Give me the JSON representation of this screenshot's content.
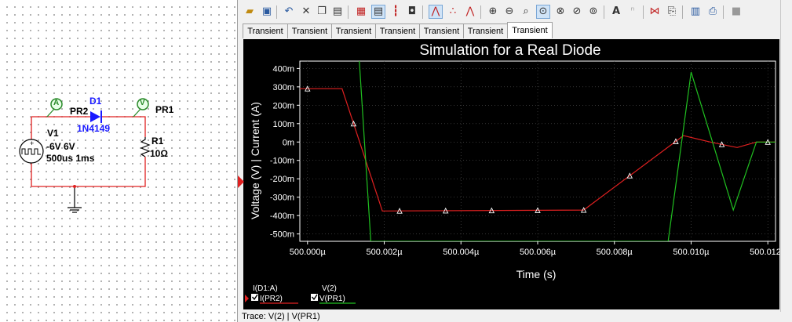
{
  "schematic": {
    "probe1": {
      "symbol": "A",
      "label": "PR2"
    },
    "probe2": {
      "symbol": "V",
      "label": "PR1"
    },
    "diode": {
      "ref": "D1",
      "model": "1N4149"
    },
    "source": {
      "ref": "V1",
      "line1": "-6V 6V",
      "line2": "500us 1ms"
    },
    "resistor": {
      "ref": "R1",
      "value": "10Ω"
    }
  },
  "toolbar": {
    "icons": [
      "open-icon",
      "save-icon",
      "undo-icon",
      "delete-icon",
      "copy-icon",
      "paste-icon",
      "grid-icon",
      "legend-icon",
      "cursor-icon",
      "dark-bg-icon",
      "line-plot-icon",
      "dot-plot-icon",
      "dotline-plot-icon",
      "zoom-in-icon",
      "zoom-out-icon",
      "zoom-area-icon",
      "zoom-full-icon",
      "zoom-x-icon",
      "zoom-y-icon",
      "text-icon",
      "overlay-icon",
      "add-trace-icon",
      "export-icon",
      "print-icon",
      "stop-icon"
    ]
  },
  "tabs": [
    "Transient",
    "Transient",
    "Transient",
    "Transient",
    "Transient",
    "Transient",
    "Transient"
  ],
  "active_tab": 6,
  "status_text": "Trace: V(2) | V(PR1)",
  "chart_data": {
    "type": "line",
    "title": "Simulation for a Real Diode",
    "xlabel": "Time (s)",
    "ylabel": "Voltage (V) | Current (A)",
    "x_ticks": [
      "500.000µ",
      "500.002µ",
      "500.004µ",
      "500.006µ",
      "500.008µ",
      "500.010µ",
      "500.012µ"
    ],
    "x_tick_values": [
      500.0,
      500.002,
      500.004,
      500.006,
      500.008,
      500.01,
      500.012
    ],
    "y_ticks": [
      "400m",
      "300m",
      "200m",
      "100m",
      "0m",
      "-100m",
      "-200m",
      "-300m",
      "-400m",
      "-500m"
    ],
    "y_tick_values": [
      0.4,
      0.3,
      0.2,
      0.1,
      0,
      -0.1,
      -0.2,
      -0.3,
      -0.4,
      -0.5
    ],
    "xlim": [
      499.9998,
      500.0122
    ],
    "ylim": [
      -0.54,
      0.44
    ],
    "grid": true,
    "background": "#000000",
    "series": [
      {
        "name": "I(D1:A)",
        "legend_sub": "I(PR2)",
        "color": "#e02020",
        "x": [
          499.9998,
          500.0009,
          500.00195,
          500.0072,
          500.0098,
          500.0105,
          500.0112,
          500.0117,
          500.0122
        ],
        "y": [
          0.29,
          0.29,
          -0.375,
          -0.37,
          0.035,
          0.0,
          -0.03,
          0.0,
          0.0
        ]
      },
      {
        "name": "V(2)",
        "legend_sub": "V(PR1)",
        "color": "#20c020",
        "x": [
          500.00135,
          500.00165,
          500.0094,
          500.01,
          500.0111,
          500.0117,
          500.0122
        ],
        "y": [
          0.44,
          -0.54,
          -0.54,
          0.38,
          -0.37,
          0.0,
          0.0
        ]
      }
    ]
  }
}
